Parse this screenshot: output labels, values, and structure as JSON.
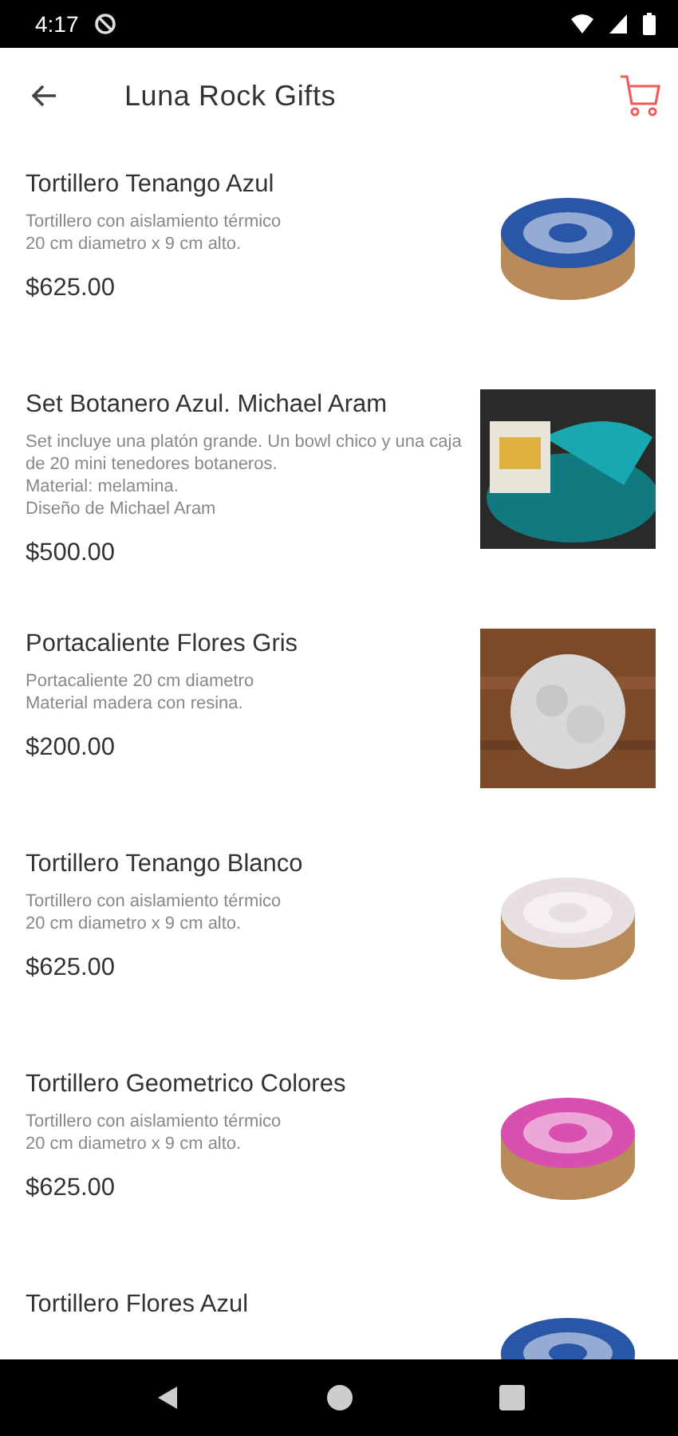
{
  "status_bar": {
    "time": "4:17"
  },
  "app_bar": {
    "title": "Luna Rock Gifts"
  },
  "products": [
    {
      "name": "Tortillero Tenango Azul",
      "description": "Tortillero con aislamiento térmico\n20 cm diametro x 9 cm alto.",
      "price": "$625.00"
    },
    {
      "name": "Set Botanero Azul. Michael Aram",
      "description": "Set incluye una platón grande. Un bowl chico y una caja de 20 mini tenedores botaneros.\nMaterial: melamina.\nDiseño de Michael Aram",
      "price": "$500.00"
    },
    {
      "name": "Portacaliente Flores Gris",
      "description": "Portacaliente 20 cm diametro\nMaterial madera con resina.",
      "price": "$200.00"
    },
    {
      "name": "Tortillero Tenango Blanco",
      "description": "Tortillero con aislamiento térmico\n20 cm diametro x 9 cm alto.",
      "price": "$625.00"
    },
    {
      "name": "Tortillero Geometrico Colores",
      "description": "Tortillero con aislamiento térmico\n20 cm diametro x 9 cm alto.",
      "price": "$625.00"
    },
    {
      "name": "Tortillero Flores Azul"
    }
  ]
}
